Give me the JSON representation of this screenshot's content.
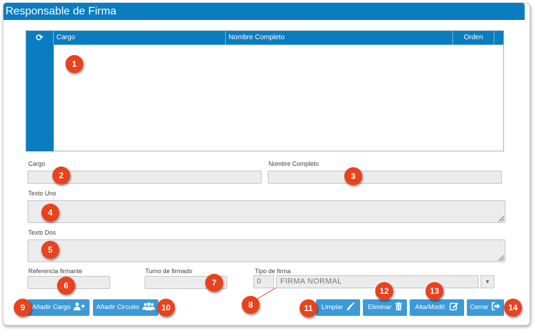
{
  "window": {
    "title": "Responsable de Firma"
  },
  "grid": {
    "refresh_glyph": "⟳",
    "columns": [
      "Cargo",
      "Nombre Completo",
      "Orden"
    ],
    "rows": []
  },
  "form": {
    "cargo_label": "Cargo",
    "nombre_label": "Nombre Completo",
    "texto_uno_label": "Texto Uno",
    "texto_dos_label": "Texto Dos",
    "referencia_label": "Referencia firmante",
    "turno_label": "Turno de firmado",
    "tipo_label": "Tipo de firma",
    "tipo_code": "0",
    "tipo_value": "FIRMA NORMAL",
    "tipo_arrow_glyph": "▼"
  },
  "buttons": {
    "anadir_cargo": "Añadir Cargo",
    "anadir_circuito": "Añadir Circuito",
    "limpiar": "Limpiar",
    "eliminar": "Eliminar",
    "alta_modif": "Alta/Modif.",
    "cerrar": "Cerrar"
  },
  "icons": {
    "anadir_cargo": "user-plus-icon",
    "anadir_circuito": "users-icon",
    "limpiar": "brush-icon",
    "eliminar": "trash-icon",
    "alta_modif": "edit-icon",
    "cerrar": "sign-out-icon"
  },
  "callouts": [
    "1",
    "2",
    "3",
    "4",
    "5",
    "6",
    "7",
    "8",
    "9",
    "10",
    "11",
    "12",
    "13",
    "14"
  ],
  "colors": {
    "header_blue": "#0a7dc1",
    "button_blue": "#3c9ad8",
    "callout_red": "#e8421e"
  }
}
